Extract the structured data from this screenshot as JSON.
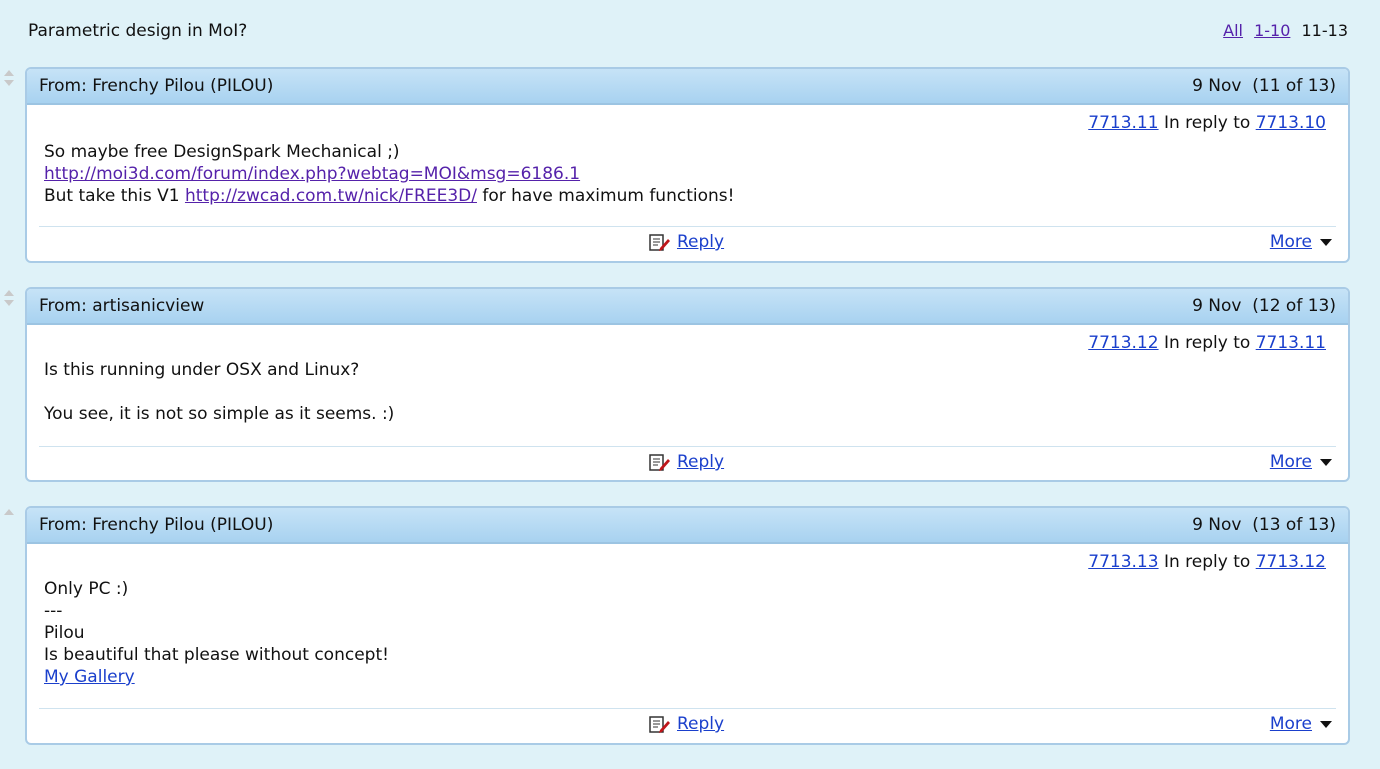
{
  "topic": {
    "title": "Parametric design in MoI?"
  },
  "pager": {
    "all": "All",
    "range1": "1-10",
    "current": "11-13"
  },
  "messages": [
    {
      "from": "From: Frenchy Pilou (PILOU)",
      "date": "9 Nov  (11 of 13)",
      "id": "7713.11",
      "in_reply": "In reply to",
      "reply_to": "7713.10",
      "line1": "So maybe free DesignSpark Mechanical ;)",
      "link1": "http://moi3d.com/forum/index.php?webtag=MOI&msg=6186.1",
      "line3_pre": "But take this V1 ",
      "link2": "http://zwcad.com.tw/nick/FREE3D/",
      "line3_post": " for have maximum functions!",
      "reply": "Reply",
      "more": "More"
    },
    {
      "from": "From: artisanicview",
      "date": "9 Nov  (12 of 13)",
      "id": "7713.12",
      "in_reply": "In reply to",
      "reply_to": "7713.11",
      "line1": "Is this running under OSX and Linux?",
      "line2": "You see, it is not so simple as it seems. :)",
      "reply": "Reply",
      "more": "More"
    },
    {
      "from": "From: Frenchy Pilou (PILOU)",
      "date": "9 Nov  (13 of 13)",
      "id": "7713.13",
      "in_reply": "In reply to",
      "reply_to": "7713.12",
      "line1": "Only PC :)",
      "line2": "---",
      "line3": "Pilou",
      "line4": "Is beautiful that please without concept!",
      "link1": "My Gallery",
      "reply": "Reply",
      "more": "More"
    }
  ],
  "icons": {
    "reply": "reply-edit-icon",
    "vote_up": "vote-up-icon",
    "vote_down": "vote-down-icon",
    "more": "chevron-down-icon"
  },
  "colors": {
    "background": "#dff2f8",
    "header": "#b5daf3",
    "link": "#1a3fcc",
    "visited": "#5522aa"
  }
}
